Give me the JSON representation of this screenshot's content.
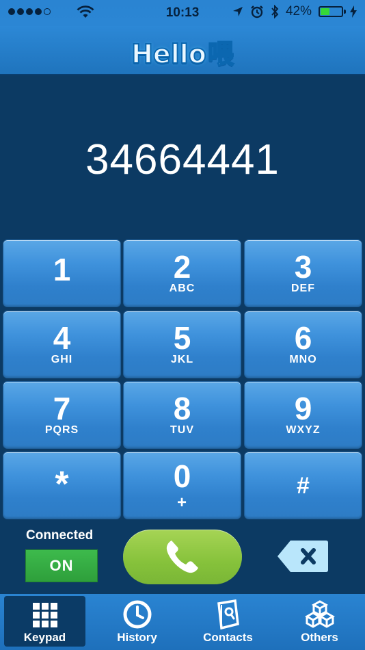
{
  "status_bar": {
    "time": "10:13",
    "battery_percent": "42%",
    "battery_level": 0.42,
    "signal_bars": 5,
    "signal_filled": 4,
    "icons": [
      "signal-icon",
      "wifi-icon",
      "location-arrow-icon",
      "alarm-clock-icon",
      "bluetooth-icon",
      "battery-icon",
      "charging-bolt-icon"
    ]
  },
  "header": {
    "logo_text": "Hello",
    "logo_glyph": "喂"
  },
  "display": {
    "dialed_number": "34664441"
  },
  "keypad": {
    "keys": [
      {
        "digit": "1",
        "letters": ""
      },
      {
        "digit": "2",
        "letters": "ABC"
      },
      {
        "digit": "3",
        "letters": "DEF"
      },
      {
        "digit": "4",
        "letters": "GHI"
      },
      {
        "digit": "5",
        "letters": "JKL"
      },
      {
        "digit": "6",
        "letters": "MNO"
      },
      {
        "digit": "7",
        "letters": "PQRS"
      },
      {
        "digit": "8",
        "letters": "TUV"
      },
      {
        "digit": "9",
        "letters": "WXYZ"
      },
      {
        "digit": "*",
        "letters": ""
      },
      {
        "digit": "0",
        "letters": "+"
      },
      {
        "digit": "#",
        "letters": ""
      }
    ]
  },
  "controls": {
    "connection_label": "Connected",
    "toggle_label": "ON",
    "toggle_color": "#36a843",
    "call_color": "#8dc63f",
    "call_icon": "phone-handset-icon",
    "backspace_icon": "backspace-icon"
  },
  "tab_bar": {
    "tabs": [
      {
        "label": "Keypad",
        "icon": "keypad-grid-icon",
        "active": true
      },
      {
        "label": "History",
        "icon": "clock-icon",
        "active": false
      },
      {
        "label": "Contacts",
        "icon": "contacts-book-icon",
        "active": false
      },
      {
        "label": "Others",
        "icon": "cubes-icon",
        "active": false
      }
    ]
  },
  "colors": {
    "background": "#0c3a63",
    "bar_blue": "#2a84d2",
    "key_blue": "#3f92dc"
  }
}
